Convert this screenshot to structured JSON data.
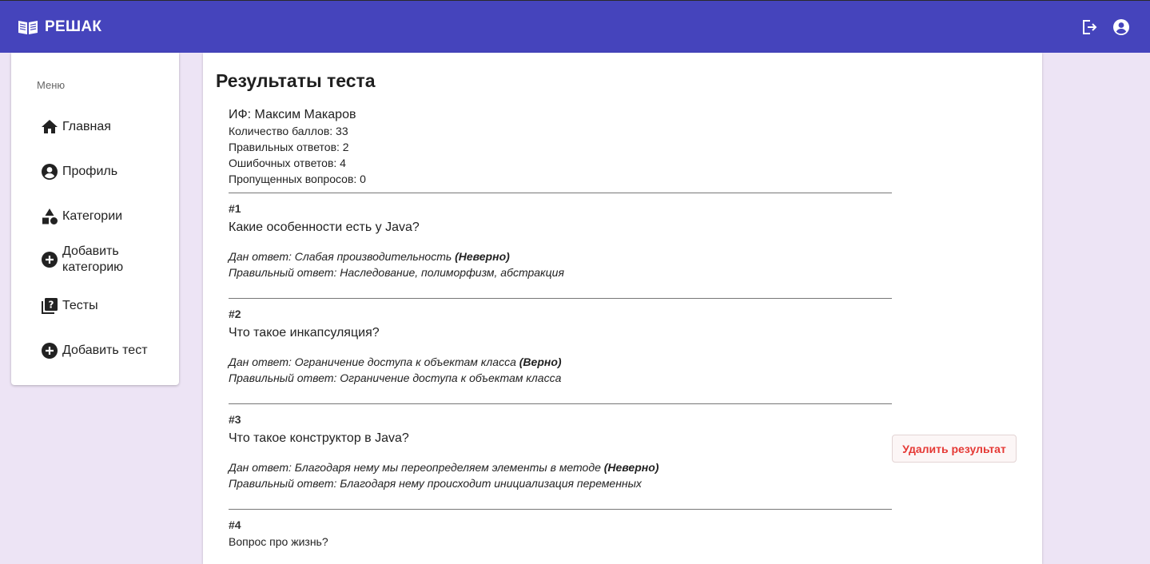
{
  "header": {
    "brand": "РЕШАК",
    "brand_icon": "book-open-icon",
    "logout_icon": "logout-icon",
    "account_icon": "account-circle-icon",
    "color": "#4544bc"
  },
  "sidebar": {
    "heading": "Меню",
    "items": [
      {
        "label": "Главная",
        "icon": "home-icon"
      },
      {
        "label": "Профиль",
        "icon": "account-circle-icon"
      },
      {
        "label": "Категории",
        "icon": "category-icon"
      },
      {
        "label": "Добавить категорию",
        "icon": "add-circle-icon"
      },
      {
        "label": "Тесты",
        "icon": "quiz-icon"
      },
      {
        "label": "Добавить тест",
        "icon": "add-circle-icon"
      }
    ]
  },
  "main": {
    "title": "Результаты теста",
    "summary": {
      "name": "ИФ: Максим Макаров",
      "score": "Количество баллов: 33",
      "correct": "Правильных ответов: 2",
      "wrong": "Ошибочных ответов: 4",
      "skipped": "Пропущенных вопросов: 0"
    },
    "questions": [
      {
        "num": "#1",
        "text": "Какие особенности есть у Java?",
        "given_prefix": "Дан ответ: Слабая производительность",
        "verdict": "(Неверно)",
        "correct": "Правильный ответ: Наследование, полиморфизм, абстракция"
      },
      {
        "num": "#2",
        "text": "Что такое инкапсуляция?",
        "given_prefix": "Дан ответ: Ограничение доступа к объектам класса",
        "verdict": "(Верно)",
        "correct": "Правильный ответ: Ограничение доступа к объектам класса"
      },
      {
        "num": "#3",
        "text": "Что такое конструктор в Java?",
        "given_prefix": "Дан ответ: Благодаря нему мы переопределяем элементы в методе",
        "verdict": "(Неверно)",
        "correct": "Правильный ответ: Благодаря нему происходит инициализация переменных"
      },
      {
        "num": "#4",
        "text": "Вопрос про жизнь?"
      }
    ],
    "delete_button": "Удалить результат"
  }
}
